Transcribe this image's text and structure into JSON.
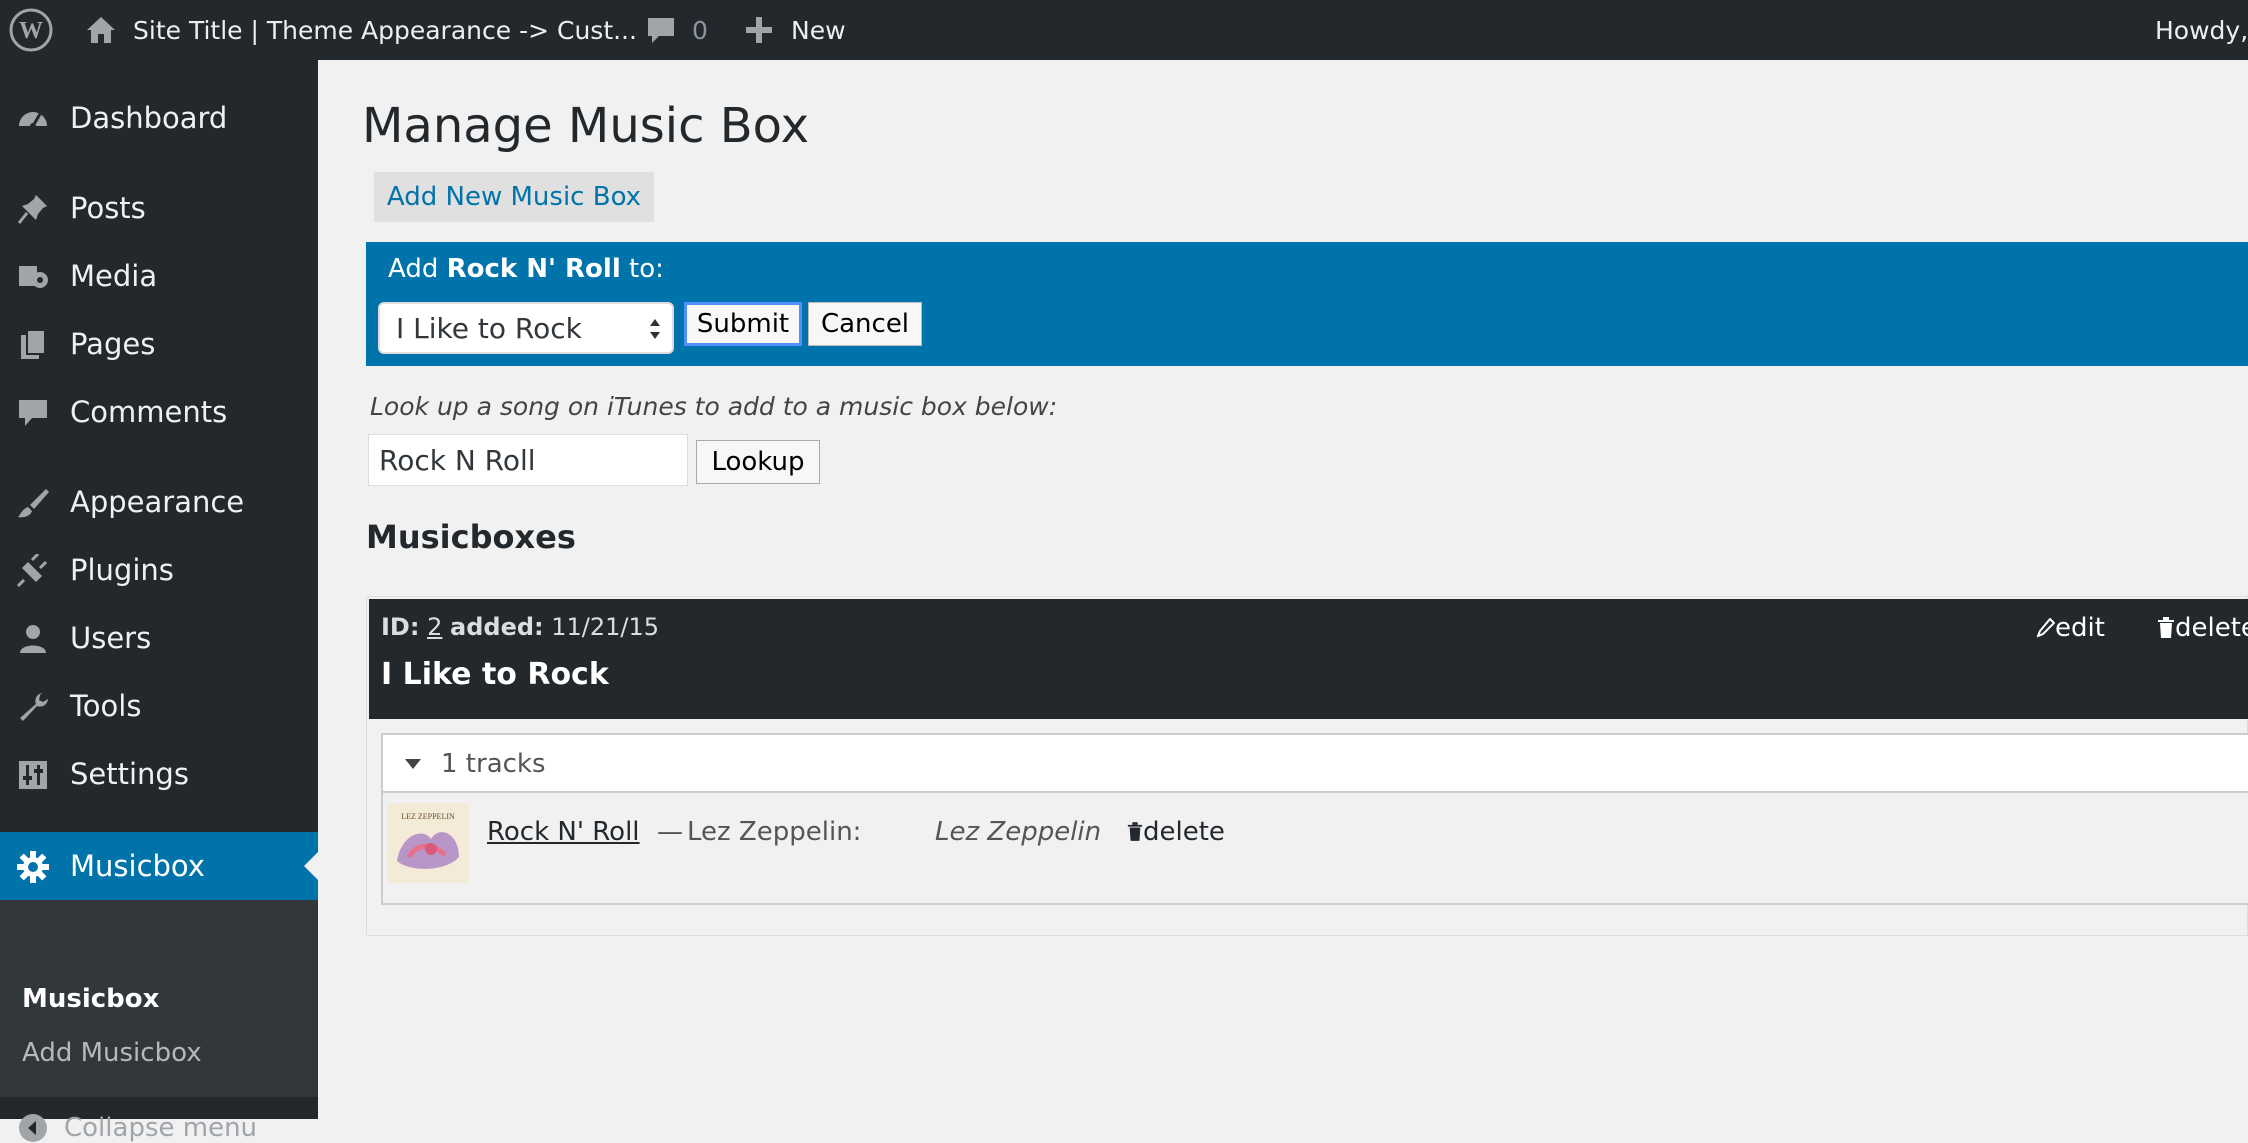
{
  "adminbar": {
    "site_title": "Site Title | Theme Appearance -> Cust...",
    "comments_count": "0",
    "new_label": "New",
    "howdy": "Howdy,"
  },
  "sidebar": {
    "items": [
      {
        "label": "Dashboard",
        "icon": "dashboard-icon"
      },
      {
        "label": "Posts",
        "icon": "pin-icon"
      },
      {
        "label": "Media",
        "icon": "media-icon"
      },
      {
        "label": "Pages",
        "icon": "pages-icon"
      },
      {
        "label": "Comments",
        "icon": "comment-icon"
      },
      {
        "label": "Appearance",
        "icon": "brush-icon"
      },
      {
        "label": "Plugins",
        "icon": "plug-icon"
      },
      {
        "label": "Users",
        "icon": "user-icon"
      },
      {
        "label": "Tools",
        "icon": "wrench-icon"
      },
      {
        "label": "Settings",
        "icon": "sliders-icon"
      },
      {
        "label": "Musicbox",
        "icon": "gear-icon"
      }
    ],
    "submenu": [
      "Musicbox",
      "Add Musicbox"
    ],
    "collapse": "Collapse menu"
  },
  "main": {
    "title": "Manage Music Box",
    "add_new": "Add New Music Box",
    "notice": {
      "prefix": "Add ",
      "song": "Rock N' Roll",
      "suffix": " to:",
      "select_value": "I Like to Rock",
      "submit": "Submit",
      "cancel": "Cancel"
    },
    "lookup": {
      "label": "Look up a song on iTunes to add to a music box below:",
      "value": "Rock N Roll",
      "button": "Lookup"
    },
    "section_title": "Musicboxes",
    "box": {
      "id_label": "ID:",
      "id": "2",
      "added_label": "added:",
      "added": "11/21/15",
      "name": "I Like to Rock",
      "edit": "edit",
      "delete": "delete",
      "tracks_count": "1 tracks",
      "track": {
        "title": "Rock N' Roll",
        "sep": "—",
        "artist": "Lez Zeppelin:",
        "album": "Lez Zeppelin",
        "delete": "delete"
      }
    }
  },
  "colors": {
    "accent": "#0073aa",
    "adminbar": "#23282d",
    "background": "#f1f1f1"
  }
}
